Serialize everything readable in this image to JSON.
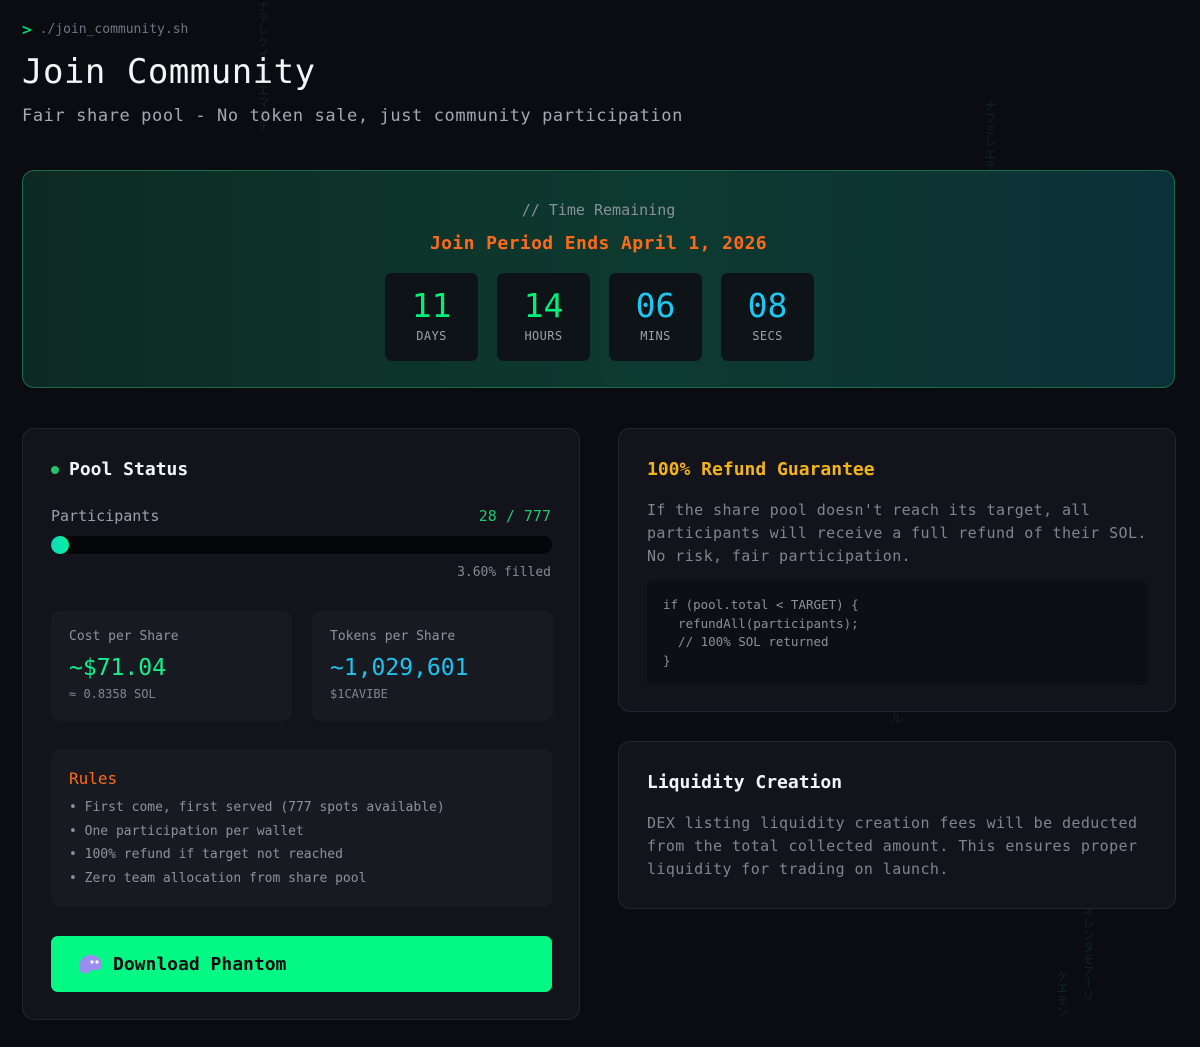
{
  "header": {
    "prompt_symbol": ">",
    "command": "./join_community.sh",
    "title": "Join Community",
    "subtitle": "Fair share pool - No token sale, just community participation"
  },
  "countdown": {
    "caption": "// Time Remaining",
    "headline": "Join Period Ends April 1, 2026",
    "units": [
      {
        "value": "11",
        "label": "DAYS",
        "color": "#00f07c"
      },
      {
        "value": "14",
        "label": "HOURS",
        "color": "#00f07c"
      },
      {
        "value": "06",
        "label": "MINS",
        "color": "#1cc8f2"
      },
      {
        "value": "08",
        "label": "SECS",
        "color": "#1cc8f2"
      }
    ]
  },
  "pool": {
    "title": "Pool Status",
    "participants_label": "Participants",
    "participants_count": "28 / 777",
    "progress_fraction": 0.036,
    "progress_text": "3.60% filled",
    "cost_label": "Cost per Share",
    "cost_value": "~$71.04",
    "cost_sub": "≈ 0.8358 SOL",
    "tokens_label": "Tokens per Share",
    "tokens_value": "~1,029,601",
    "tokens_sub": "$1CAVIBE",
    "rules_title": "Rules",
    "rules": [
      "• First come, first served (777 spots available)",
      "• One participation per wallet",
      "• 100% refund if target not reached",
      "• Zero team allocation from share pool"
    ],
    "button_label": "Download Phantom"
  },
  "refund": {
    "title": "100% Refund Guarantee",
    "text": "If the share pool doesn't reach its target, all participants will receive a full refund of their SOL. No risk, fair participation.",
    "code_lines": [
      "if (pool.total < TARGET) {",
      "  refundAll(participants);",
      "  // 100% SOL returned",
      "}"
    ]
  },
  "liquidity": {
    "title": "Liquidity Creation",
    "text": "DEX listing liquidity creation fees will be deducted from the total collected amount. This ensures proper liquidity for trading on launch."
  },
  "colors": {
    "accent_green": "#03f983",
    "accent_orange": "#ff6a1a",
    "accent_gold": "#f2b419",
    "accent_cyan": "#1cc8f2"
  }
}
